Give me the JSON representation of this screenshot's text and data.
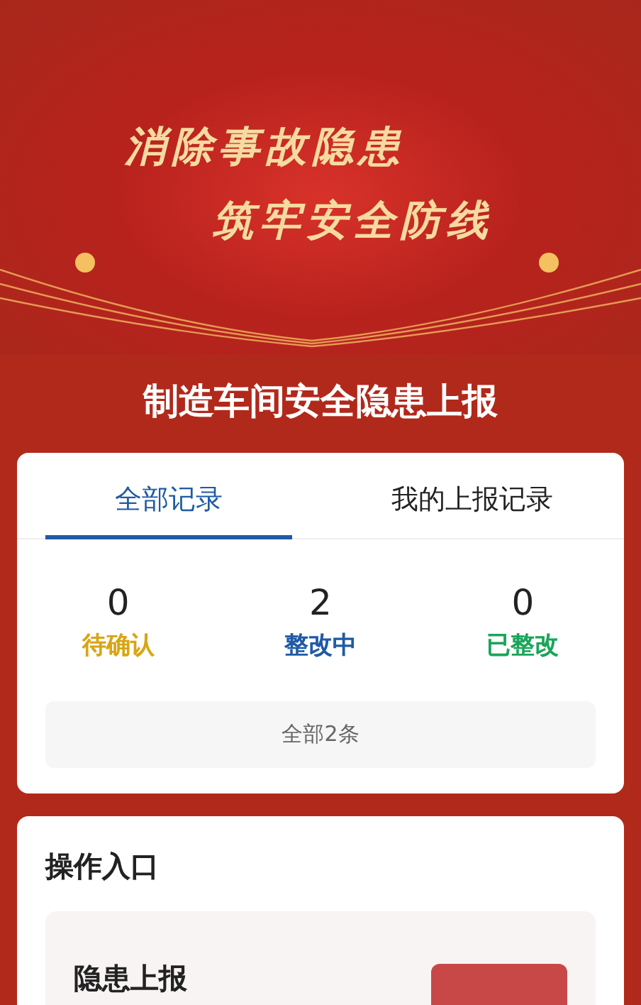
{
  "banner": {
    "lines": [
      "消除事故隐患",
      "筑牢安全防线"
    ]
  },
  "title": "制造车间安全隐患上报",
  "tabs": [
    {
      "label": "全部记录",
      "selected": true
    },
    {
      "label": "我的上报记录",
      "selected": false
    }
  ],
  "stats": [
    {
      "count": "0",
      "label": "待确认",
      "color": "#d9a514"
    },
    {
      "count": "2",
      "label": "整改中",
      "color": "#1f5aa6"
    },
    {
      "count": "0",
      "label": "已整改",
      "color": "#1aa55a"
    }
  ],
  "total": "全部2条",
  "entry": {
    "heading": "操作入口",
    "item": {
      "title": "隐患上报"
    }
  }
}
